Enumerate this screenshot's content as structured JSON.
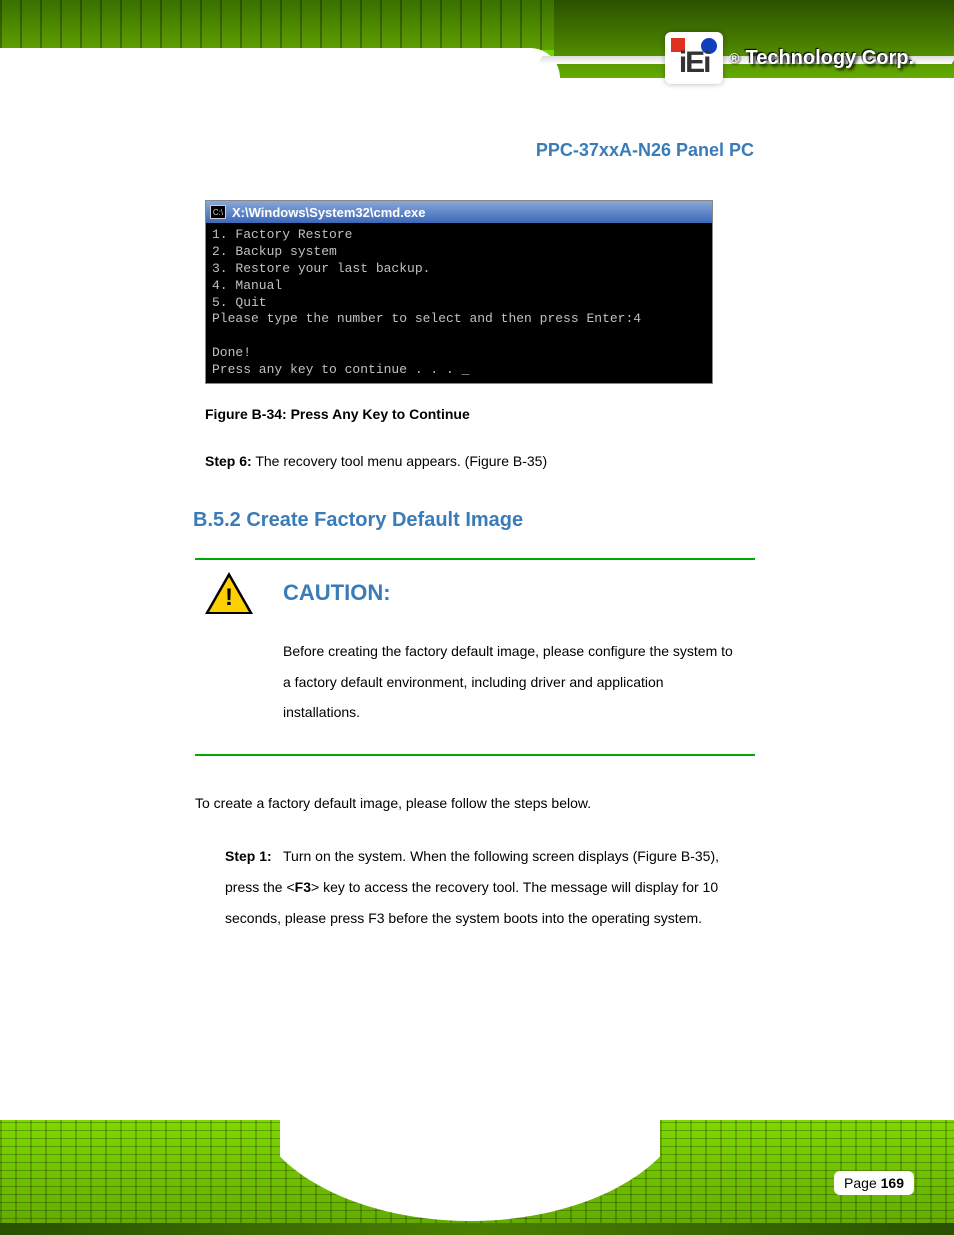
{
  "header": {
    "logo_registered": "®",
    "logo_company": "Technology Corp.",
    "logo_letters": "iEi"
  },
  "product_name": "PPC-37xxA-N26 Panel PC",
  "cmd": {
    "title": "X:\\Windows\\System32\\cmd.exe",
    "body": "1. Factory Restore\n2. Backup system\n3. Restore your last backup.\n4. Manual\n5. Quit\nPlease type the number to select and then press Enter:4\n\nDone!\nPress any key to continue . . . _"
  },
  "figure_caption": "Figure B-34: Press Any Key to Continue",
  "step6": {
    "label": "Step 6:",
    "text": "The recovery tool menu appears. (Figure B-35)"
  },
  "section_heading": "B.5.2  Create Factory Default Image",
  "caution": {
    "label": "CAUTION:",
    "text": "Before creating the factory default image, please configure the system to a factory default environment, including driver and application installations."
  },
  "body_paragraph": "To create a factory default image, please follow the steps below.",
  "stepA": {
    "label": "Step 1:",
    "text_part1": "Turn on the system. When the following screen displays (Figure B-35), press the <",
    "key": "F3",
    "text_part2": "> key to access the recovery tool. The message will display for 10 seconds, please press F3 before the system boots into the operating system."
  },
  "footer": {
    "page_label": "Page ",
    "page_number": "169"
  }
}
